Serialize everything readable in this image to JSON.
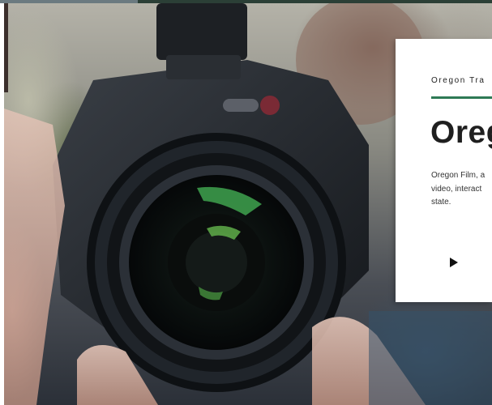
{
  "hero": {
    "image_alt": "Camera lens close-up with photographer"
  },
  "card": {
    "eyebrow": "Oregon Tra",
    "title": "Oreg",
    "description_lines": [
      "Oregon Film, a",
      "video, interact",
      "state."
    ],
    "play_icon": "play-icon"
  },
  "colors": {
    "accent_green": "#2e7a55",
    "title_text": "#1f1f1f"
  }
}
